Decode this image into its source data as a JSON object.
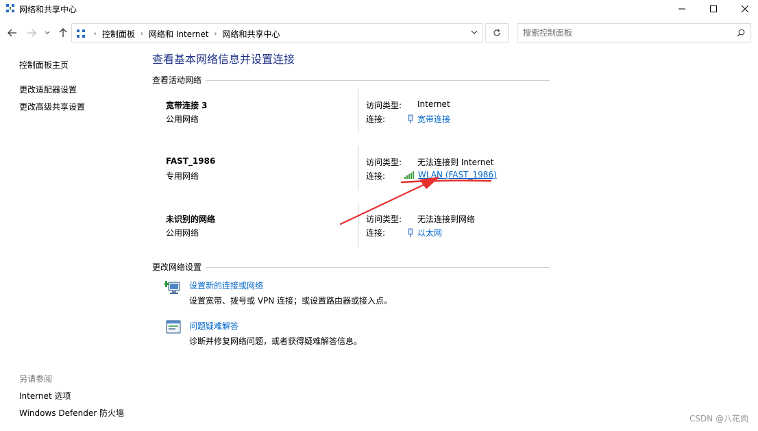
{
  "window": {
    "title": "网络和共享中心",
    "app_icon": "network-center-icon",
    "controls": [
      "minimize-icon",
      "maximize-icon",
      "close-icon"
    ]
  },
  "navigation": {
    "breadcrumbs": [
      "控制面板",
      "网络和 Internet",
      "网络和共享中心"
    ],
    "search_placeholder": "搜索控制面板"
  },
  "sidebar": {
    "home": "控制面板主页",
    "links": [
      "更改适配器设置",
      "更改高级共享设置"
    ],
    "see_also_title": "另请参阅",
    "see_also": [
      "Internet 选项",
      "Windows Defender 防火墙"
    ]
  },
  "main": {
    "title": "查看基本网络信息并设置连接",
    "active_networks_header": "查看活动网络",
    "access_type_label": "访问类型:",
    "connections_label": "连接:",
    "networks": [
      {
        "name": "宽带连接 3",
        "type": "公用网络",
        "access": "Internet",
        "connection": "宽带连接",
        "connection_icon": "dialup-icon"
      },
      {
        "name": "FAST_1986",
        "type": "专用网络",
        "access": "无法连接到 Internet",
        "connection": "WLAN (FAST_1986)",
        "connection_icon": "wifi-signal-icon"
      },
      {
        "name": "未识别的网络",
        "type": "公用网络",
        "access": "无法连接到网络",
        "connection": "以太网",
        "connection_icon": "ethernet-icon"
      }
    ],
    "change_settings_header": "更改网络设置",
    "tasks": [
      {
        "link": "设置新的连接或网络",
        "desc": "设置宽带、拨号或 VPN 连接；或设置路由器或接入点。",
        "icon": "new-connection-icon"
      },
      {
        "link": "问题疑难解答",
        "desc": "诊断并修复网络问题，或者获得疑难解答信息。",
        "icon": "troubleshoot-icon"
      }
    ]
  },
  "annotation": {
    "color": "#e53030"
  },
  "watermark": "CSDN @八花肉"
}
